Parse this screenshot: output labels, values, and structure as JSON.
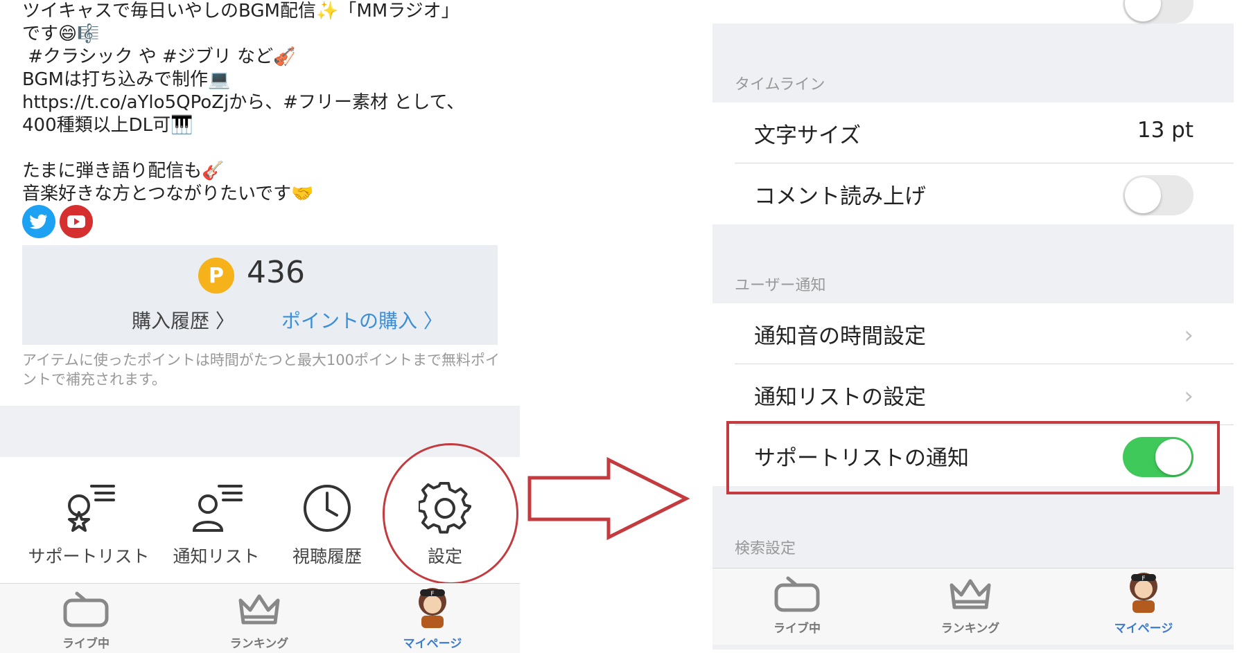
{
  "left": {
    "bio_lines": [
      "ツイキャスで毎日いやしのBGM配信✨「MMラジオ」",
      "です😄🎼",
      " #クラシック や #ジブリ など🎻",
      "BGMは打ち込みで制作💻",
      "https://t.co/aYlo5QPoZjから、#フリー素材 として、",
      "400種類以上DL可🎹",
      "",
      "たまに弾き語り配信も🎸",
      "音楽好きな方とつながりたいです🤝"
    ],
    "social": {
      "twitter_icon": "twitter-icon",
      "youtube_icon": "youtube-icon"
    },
    "points": {
      "coin_letter": "P",
      "value": "436",
      "purchase_history": "購入履歴 〉",
      "buy_points": "ポイントの購入 〉",
      "note": "アイテムに使ったポイントは時間がたつと最大100ポイントまで無料ポイントで補充されます。"
    },
    "menu": [
      {
        "label": "サポートリスト",
        "icon": "support-list-icon"
      },
      {
        "label": "通知リスト",
        "icon": "notify-list-icon"
      },
      {
        "label": "視聴履歴",
        "icon": "clock-icon"
      },
      {
        "label": "設定",
        "icon": "gear-icon"
      }
    ],
    "tabs": [
      {
        "label": "ライブ中",
        "icon": "tv-icon"
      },
      {
        "label": "ランキング",
        "icon": "crown-icon"
      },
      {
        "label": "マイページ",
        "icon": "avatar",
        "active": true
      }
    ]
  },
  "right": {
    "sections": {
      "timeline": "タイムライン",
      "user_notify": "ユーザー通知",
      "search": "検索設定"
    },
    "rows": {
      "font_size_label": "文字サイズ",
      "font_size_value": "13 pt",
      "comment_readout": "コメント読み上げ",
      "notify_sound_time": "通知音の時間設定",
      "notify_list_settings": "通知リストの設定",
      "support_list_notify": "サポートリストの通知"
    },
    "toggles": {
      "top": false,
      "comment_readout": false,
      "support_list_notify": true
    },
    "tabs": [
      {
        "label": "ライブ中",
        "icon": "tv-icon"
      },
      {
        "label": "ランキング",
        "icon": "crown-icon"
      },
      {
        "label": "マイページ",
        "icon": "avatar",
        "active": true
      }
    ]
  },
  "colors": {
    "accent_blue": "#3b8fd8",
    "toggle_on": "#3fc95a",
    "highlight_red": "#c33a3f",
    "coin": "#f6b21b"
  }
}
